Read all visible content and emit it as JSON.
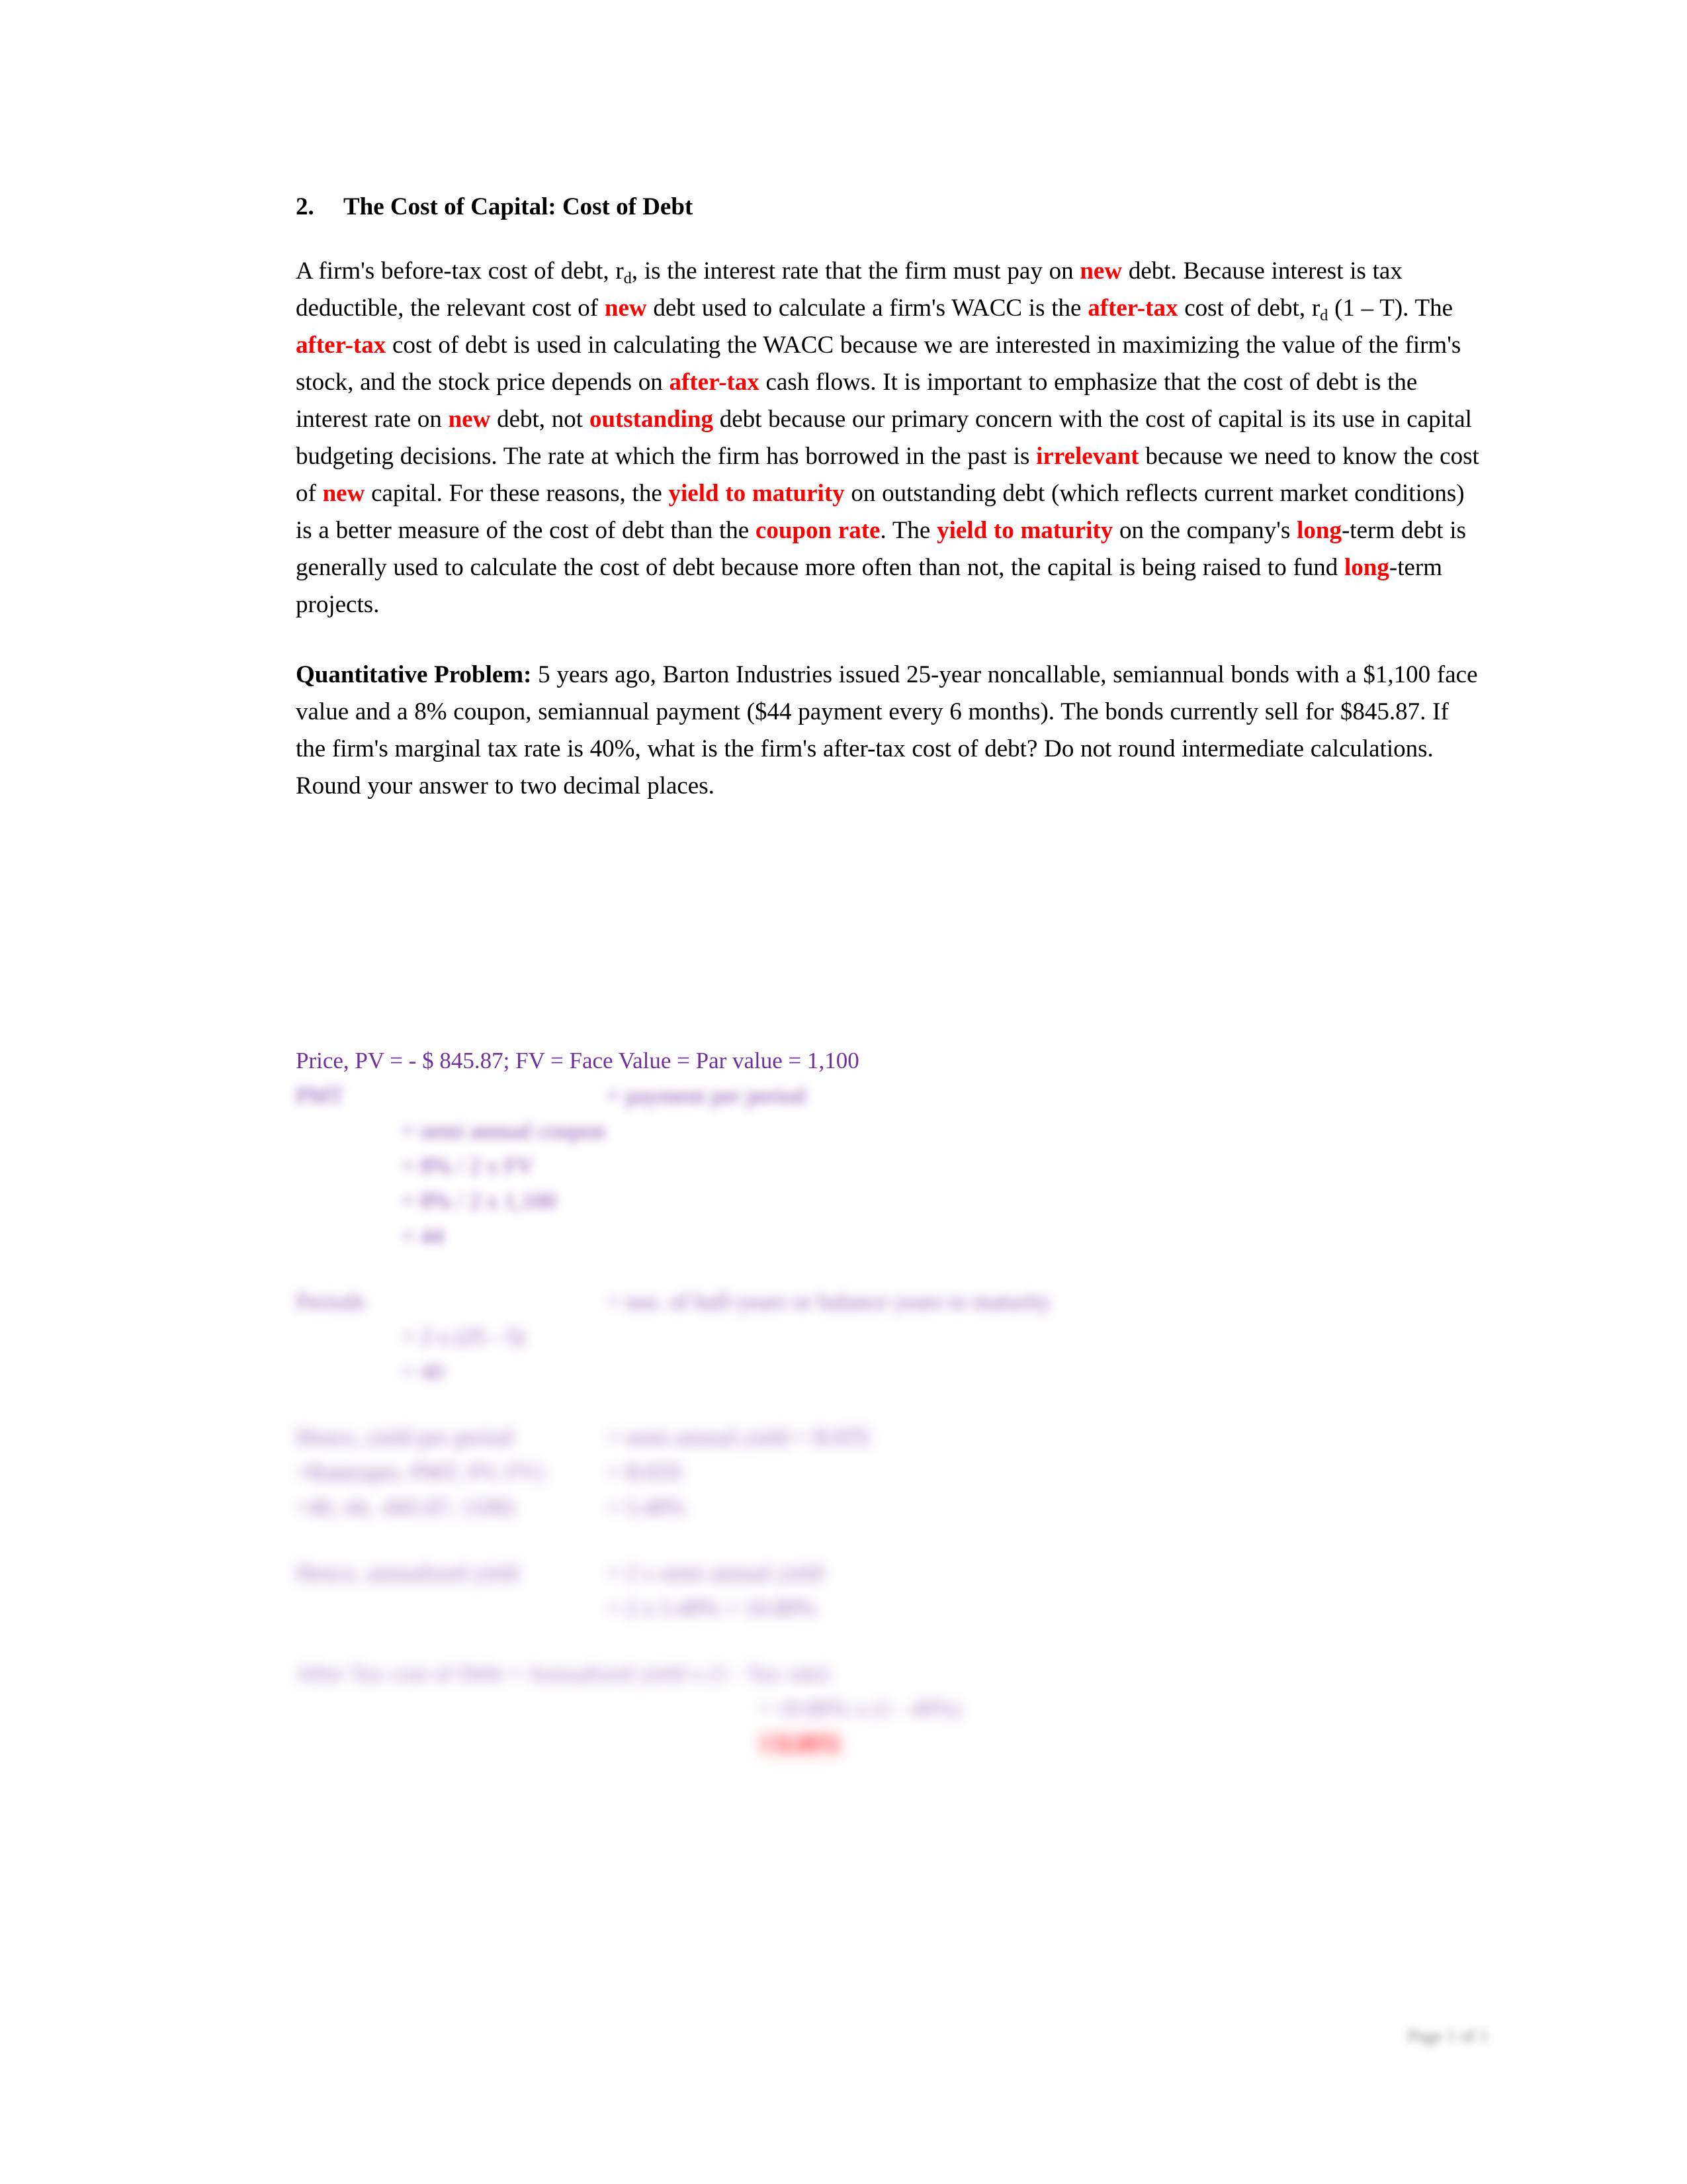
{
  "document": {
    "heading": {
      "number": "2.",
      "title": "The Cost of Capital: Cost of Debt"
    },
    "paragraph_1": {
      "segments": [
        {
          "text": "A firm's before-tax cost of debt, r",
          "style": "normal"
        },
        {
          "text": "d",
          "style": "sub"
        },
        {
          "text": ", is the interest rate that the firm must pay on ",
          "style": "normal"
        },
        {
          "text": "new",
          "style": "red"
        },
        {
          "text": " debt. Because interest is tax deductible, the relevant cost of ",
          "style": "normal"
        },
        {
          "text": "new",
          "style": "red"
        },
        {
          "text": " debt used to calculate a firm's WACC is the ",
          "style": "normal"
        },
        {
          "text": "after-tax",
          "style": "red"
        },
        {
          "text": " cost of debt, r",
          "style": "normal"
        },
        {
          "text": "d",
          "style": "sub"
        },
        {
          "text": " (1 – T). The ",
          "style": "normal"
        },
        {
          "text": "after-tax",
          "style": "red"
        },
        {
          "text": " cost of debt is used in calculating the WACC because we are interested in maximizing the value of the firm's stock, and the stock price depends on ",
          "style": "normal"
        },
        {
          "text": "after-tax",
          "style": "red"
        },
        {
          "text": " cash flows. It is important to emphasize that the cost of debt is the interest rate on ",
          "style": "normal"
        },
        {
          "text": "new",
          "style": "red"
        },
        {
          "text": " debt, not ",
          "style": "normal"
        },
        {
          "text": "outstanding",
          "style": "red"
        },
        {
          "text": " debt because our primary concern with the cost of capital is its use in capital budgeting decisions. The rate at which the firm has borrowed in the past is ",
          "style": "normal"
        },
        {
          "text": "irrelevant",
          "style": "red"
        },
        {
          "text": " because we need to know the cost of ",
          "style": "normal"
        },
        {
          "text": "new",
          "style": "red"
        },
        {
          "text": " capital. For these reasons, the ",
          "style": "normal"
        },
        {
          "text": "yield to maturity",
          "style": "red"
        },
        {
          "text": " on outstanding debt (which reflects current market conditions) is a better measure of the cost of debt than the ",
          "style": "normal"
        },
        {
          "text": "coupon rate",
          "style": "red"
        },
        {
          "text": ". The ",
          "style": "normal"
        },
        {
          "text": "yield to maturity",
          "style": "red"
        },
        {
          "text": " on the company's ",
          "style": "normal"
        },
        {
          "text": "long",
          "style": "red"
        },
        {
          "text": "-term debt is generally used to calculate the cost of debt because more often than not, the capital is being raised to fund ",
          "style": "normal"
        },
        {
          "text": "long",
          "style": "red"
        },
        {
          "text": "-term projects.",
          "style": "normal"
        }
      ]
    },
    "paragraph_2": {
      "segments": [
        {
          "text": "Quantitative Problem:",
          "style": "bold"
        },
        {
          "text": " 5 years ago, Barton Industries issued 25-year noncallable, semiannual bonds with a $1,100 face value and a 8% coupon, semiannual payment ($44 payment every 6 months). The bonds currently sell for $845.87. If the firm's marginal tax rate is 40%, what is the firm's after-tax cost of debt? Do not round intermediate calculations. Round your answer to two decimal places.",
          "style": "normal"
        }
      ]
    },
    "solution": {
      "line_price": "Price, PV = - $ 845.87; FV = Face Value = Par value = 1,100",
      "group_pmt": {
        "label": "PMT",
        "lines": [
          "= payment per period",
          "= semi annual coupon",
          "= 8% / 2 x FV",
          "= 8% / 2 x 1,100",
          "= 44"
        ]
      },
      "group_periods": {
        "label": "Periods",
        "lines": [
          "= nos. of half-years or balance years to maturity",
          "= 2 x (25 - 5)",
          "= 40"
        ]
      },
      "group_rates": {
        "rows": [
          {
            "left": "Hence, yield per period",
            "right": "= semi annual yield = RATE"
          },
          {
            "left": "=Rate(nper, PMT, PV, FV)",
            "right": "= RATE"
          },
          {
            "left": "=40, 44, -845.87, 1100)",
            "right": "= 5.40%"
          }
        ]
      },
      "group_annualized": {
        "rows": [
          {
            "left": "Hence, annualized yield",
            "right": "= 2 x semi annual yield"
          },
          {
            "left": "",
            "right": "= 2 x 5.40% = 10.80%"
          }
        ]
      },
      "group_aftertax": {
        "line_1": "After Tax cost of Debt = Annualized yield x (1 - Tax rate)",
        "line_2": "= 10.80% x (1 - 40%)",
        "answer": "= 6.48%"
      }
    },
    "footer": {
      "page_label": "Page 1 of 1"
    },
    "colors": {
      "emphasis_red": "#FF0000",
      "solution_purple": "#7030A0",
      "answer_highlight": "#FFC7CE",
      "text_black": "#000000",
      "footer_grey": "#595959"
    }
  }
}
